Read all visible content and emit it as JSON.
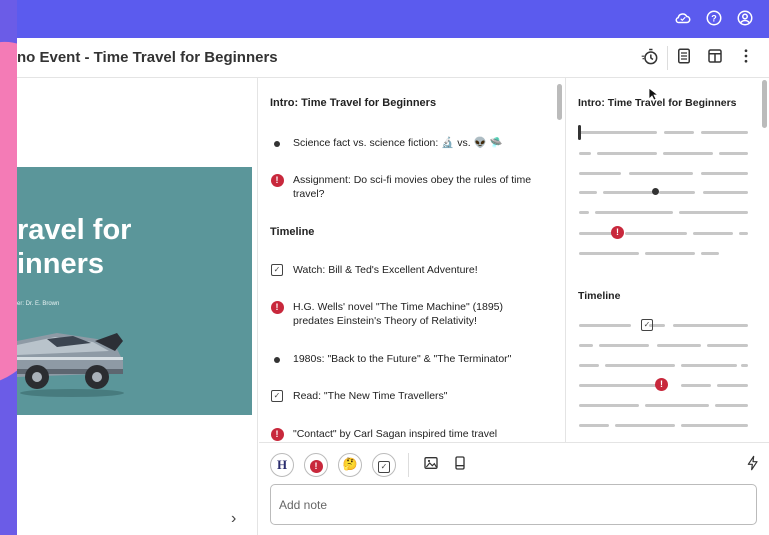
{
  "window": {
    "title": "no Event - Time Travel for Beginners",
    "topbar_icons": [
      "cloud-icon",
      "help-icon",
      "account-icon"
    ],
    "header_icons": [
      "timer-icon",
      "notes-icon",
      "layout-icon",
      "more-icon"
    ],
    "accent_color": "#5b5bee",
    "alert_color": "#c8283c"
  },
  "slide": {
    "title_line1": "ravel for",
    "title_line2": "inners",
    "presenter": "er: Dr. E. Brown",
    "background": "#5b969a",
    "next_label": "›"
  },
  "outline": {
    "section1": "Intro: Time Travel for Beginners",
    "items1": [
      {
        "type": "bullet",
        "text": "Science fact vs. science fiction: 🔬 vs. 👽 🛸"
      },
      {
        "type": "alert",
        "text": "Assignment: Do sci-fi movies obey the rules of time travel?"
      }
    ],
    "section2": "Timeline",
    "items2": [
      {
        "type": "check",
        "text": "Watch: Bill & Ted's Excellent Adventure!"
      },
      {
        "type": "alert",
        "text": "H.G. Wells' novel \"The Time Machine\" (1895) predates Einstein's Theory of Relativity!"
      },
      {
        "type": "bullet",
        "text": "1980s: \"Back to the Future\" & \"The Terminator\""
      },
      {
        "type": "check",
        "text": "Read: \"The New Time Travellers\""
      },
      {
        "type": "alert",
        "text": "\"Contact\" by Carl Sagan inspired time travel"
      }
    ]
  },
  "minimap": {
    "section1": "Intro: Time Travel for Beginners",
    "section2": "Timeline"
  },
  "toolbar": {
    "heading_btn": "H",
    "alert_btn": "!",
    "emoji_btn": "🤔",
    "check_btn": "✓",
    "image_icon": "image-icon",
    "slide_icon": "slide-icon",
    "bolt_icon": "lightning-icon",
    "note_placeholder": "Add note"
  }
}
